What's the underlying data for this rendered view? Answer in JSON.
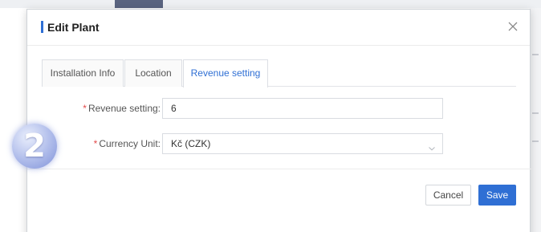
{
  "modal": {
    "title": "Edit Plant",
    "close_icon": "close-icon"
  },
  "tabs": [
    {
      "label": "Installation Info",
      "active": false
    },
    {
      "label": "Location",
      "active": false
    },
    {
      "label": "Revenue setting",
      "active": true
    }
  ],
  "form": {
    "revenue": {
      "required_mark": "*",
      "label": "Revenue setting:",
      "value": "6"
    },
    "currency": {
      "required_mark": "*",
      "label": "Currency Unit:",
      "value": "Kč (CZK)",
      "icon": "chevron-down-icon"
    }
  },
  "buttons": {
    "cancel": "Cancel",
    "save": "Save"
  },
  "step_badge": {
    "number": "2"
  },
  "colors": {
    "accent": "#2f6fd4",
    "required": "#e34a4a",
    "badge": "#aebbea"
  }
}
